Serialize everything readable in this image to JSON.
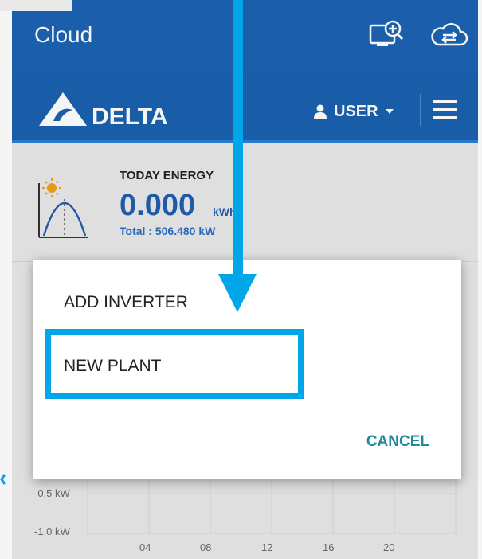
{
  "appbar": {
    "title": "Cloud",
    "icons": [
      "device-search-icon",
      "cloud-sync-icon"
    ]
  },
  "brand": {
    "logo_text": "DELTA",
    "user_label": "USER"
  },
  "energy": {
    "label": "TODAY ENERGY",
    "value": "0.000",
    "unit": "kWh",
    "total": "Total : 506.480 kW"
  },
  "chart": {
    "y_labels": [
      "-0.5 kW",
      "-1.0 kW"
    ],
    "x_labels": [
      "04",
      "08",
      "12",
      "16",
      "20"
    ]
  },
  "dialog": {
    "items": [
      "ADD INVERTER",
      "NEW PLANT"
    ],
    "cancel_label": "CANCEL"
  },
  "colors": {
    "appbar": "#1d63b3",
    "accent_blue": "#00a6e8",
    "energy_blue": "#1f5fb0",
    "cancel_teal": "#1f8a9a"
  }
}
